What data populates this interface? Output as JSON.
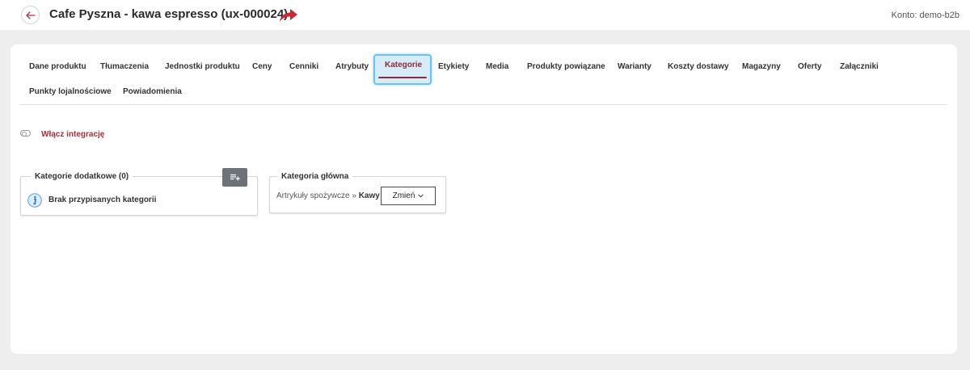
{
  "header": {
    "title": "Cafe Pyszna - kawa espresso (ux-000024)",
    "account": "Konto: demo-b2b"
  },
  "tabs": [
    {
      "label": "Dane produktu",
      "active": false
    },
    {
      "label": "Tłumaczenia",
      "active": false
    },
    {
      "label": "Jednostki produktu",
      "active": false
    },
    {
      "label": "Ceny",
      "active": false
    },
    {
      "label": "Cenniki",
      "active": false
    },
    {
      "label": "Atrybuty",
      "active": false
    },
    {
      "label": "Kategorie",
      "active": true
    },
    {
      "label": "Etykiety",
      "active": false
    },
    {
      "label": "Media",
      "active": false
    },
    {
      "label": "Produkty powiązane",
      "active": false
    },
    {
      "label": "Warianty",
      "active": false
    },
    {
      "label": "Koszty dostawy",
      "active": false
    },
    {
      "label": "Magazyny",
      "active": false
    },
    {
      "label": "Oferty",
      "active": false
    },
    {
      "label": "Załączniki",
      "active": false
    },
    {
      "label": "Punkty lojalnościowe",
      "active": false
    },
    {
      "label": "Powiadomienia",
      "active": false
    }
  ],
  "integration": {
    "toggle_label": "Włącz integrację",
    "enabled": false
  },
  "additional_categories": {
    "legend": "Kategorie dodatkowe (0)",
    "empty_message": "Brak przypisanych kategorii"
  },
  "main_category": {
    "legend": "Kategoria główna",
    "parent": "Artrykuły spożywcze",
    "separator": "»",
    "name": "Kawy",
    "change_label": "Zmień"
  },
  "colors": {
    "accent": "#8c2a3a",
    "active_tab_bg": "#d6ecf9",
    "active_tab_border": "#6bc3ee",
    "link": "#a82e3e"
  },
  "icons": {
    "back": "arrow-left-icon",
    "share": "share-arrow-icon",
    "add": "playlist-add-icon",
    "info": "info-icon",
    "chevron": "chevron-down-icon"
  }
}
